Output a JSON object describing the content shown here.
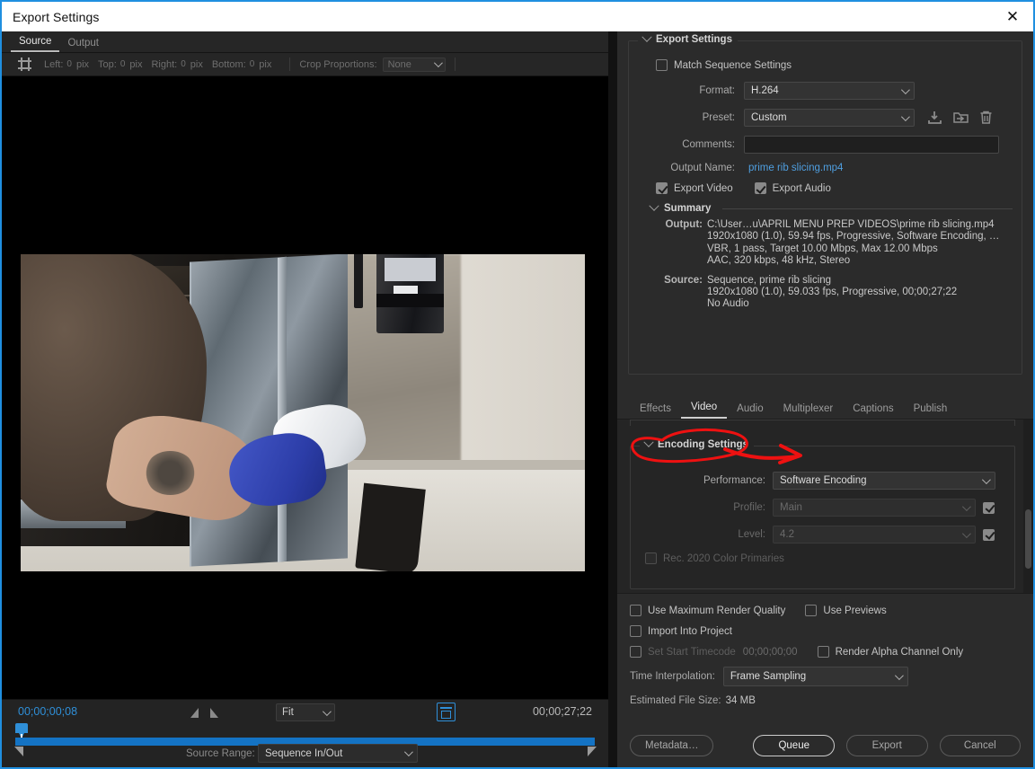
{
  "window": {
    "title": "Export Settings",
    "close_icon": "close-icon"
  },
  "source_panel": {
    "tabs": [
      {
        "label": "Source",
        "active": true
      },
      {
        "label": "Output",
        "active": false
      }
    ],
    "crop_bar": {
      "crop_icon": "crop-icon",
      "left_label": "Left:",
      "left_value": "0",
      "left_unit": "pix",
      "top_label": "Top:",
      "top_value": "0",
      "top_unit": "pix",
      "right_label": "Right:",
      "right_value": "0",
      "right_unit": "pix",
      "bottom_label": "Bottom:",
      "bottom_value": "0",
      "bottom_unit": "pix",
      "proportions_label": "Crop Proportions:",
      "proportions_value": "None"
    },
    "preview_description": "Person in brown fleece with tattooed forearm wearing a blue glove wiping the inside of a stainless steel oven with a white cloth",
    "timeline": {
      "current_timecode": "00;00;00;08",
      "duration_timecode": "00;00;27;22",
      "zoom_value": "Fit",
      "ratio_icon": "aspect-ratio-icon",
      "source_range_label": "Source Range:",
      "source_range_value": "Sequence In/Out"
    }
  },
  "export_settings": {
    "group_title": "Export Settings",
    "match_sequence_label": "Match Sequence Settings",
    "match_sequence_checked": false,
    "format_label": "Format:",
    "format_value": "H.264",
    "preset_label": "Preset:",
    "preset_value": "Custom",
    "preset_icons": [
      "save-preset-icon",
      "import-preset-icon",
      "delete-preset-icon"
    ],
    "comments_label": "Comments:",
    "comments_value": "",
    "comments_placeholder": "",
    "output_name_label": "Output Name:",
    "output_name_value": "prime rib slicing.mp4",
    "export_video_label": "Export Video",
    "export_video_checked": true,
    "export_audio_label": "Export Audio",
    "export_audio_checked": true,
    "summary": {
      "title": "Summary",
      "output_label": "Output:",
      "output_lines": [
        "C:\\User…u\\APRIL MENU PREP VIDEOS\\prime rib slicing.mp4",
        "1920x1080 (1.0), 59.94 fps, Progressive, Software Encoding, …",
        "VBR, 1 pass, Target 10.00 Mbps, Max 12.00 Mbps",
        "AAC, 320 kbps, 48 kHz, Stereo"
      ],
      "source_label": "Source:",
      "source_lines": [
        "Sequence, prime rib slicing",
        "1920x1080 (1.0), 59.033 fps, Progressive, 00;00;27;22",
        "No Audio"
      ]
    }
  },
  "settings_tabs": [
    {
      "label": "Effects",
      "active": false
    },
    {
      "label": "Video",
      "active": true
    },
    {
      "label": "Audio",
      "active": false
    },
    {
      "label": "Multiplexer",
      "active": false
    },
    {
      "label": "Captions",
      "active": false
    },
    {
      "label": "Publish",
      "active": false
    }
  ],
  "encoding_settings": {
    "group_title": "Encoding Settings",
    "performance_label": "Performance:",
    "performance_value": "Software Encoding",
    "profile_label": "Profile:",
    "profile_value": "Main",
    "profile_checked": true,
    "level_label": "Level:",
    "level_value": "4.2",
    "level_checked": true,
    "rec2020_label": "Rec. 2020 Color Primaries",
    "rec2020_checked": false
  },
  "annotation": {
    "shape": "red-ellipse-with-arrow",
    "color": "#ee1111",
    "target": "Encoding Settings"
  },
  "options": {
    "max_render_quality_label": "Use Maximum Render Quality",
    "max_render_quality_checked": false,
    "use_previews_label": "Use Previews",
    "use_previews_checked": false,
    "import_into_project_label": "Import Into Project",
    "import_into_project_checked": false,
    "set_start_timecode_label": "Set Start Timecode",
    "set_start_timecode_checked": false,
    "start_timecode_value": "00;00;00;00",
    "render_alpha_label": "Render Alpha Channel Only",
    "render_alpha_checked": false,
    "time_interpolation_label": "Time Interpolation:",
    "time_interpolation_value": "Frame Sampling",
    "estimated_size_label": "Estimated File Size:",
    "estimated_size_value": "34 MB"
  },
  "buttons": {
    "metadata": "Metadata…",
    "queue": "Queue",
    "export": "Export",
    "cancel": "Cancel"
  },
  "colors": {
    "accent_blue": "#2f8fd8",
    "link_blue": "#4f9fe0",
    "annotation_red": "#ee1111"
  }
}
